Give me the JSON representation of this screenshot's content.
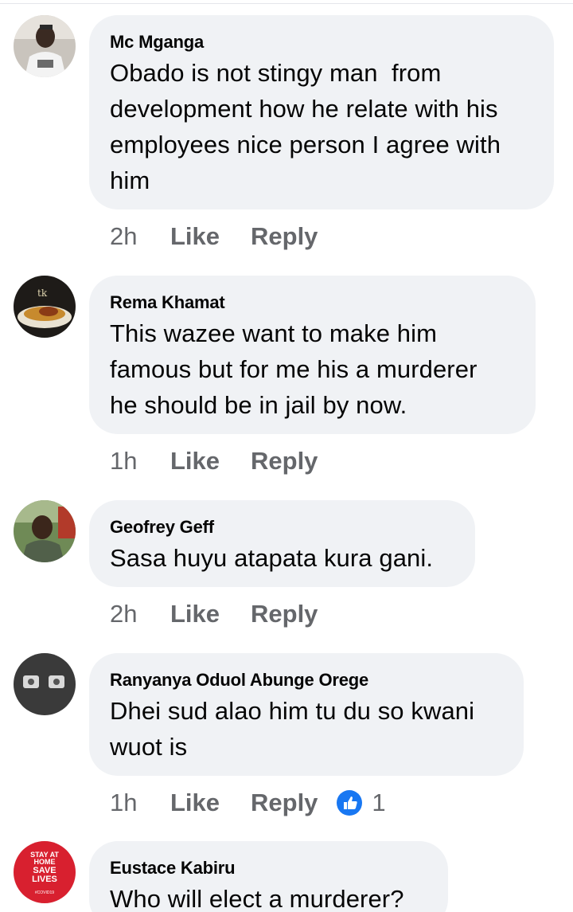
{
  "comments": [
    {
      "author": "Mc Mganga",
      "text_lines": [
        "Obado is not stingy man  from",
        "development how he relate with his",
        "employees nice person I agree with",
        "him"
      ],
      "time": "2h",
      "like_label": "Like",
      "reply_label": "Reply"
    },
    {
      "author": "Rema Khamat",
      "text_lines": [
        "This wazee want to make him",
        "famous but for me his a murderer",
        "he should be in jail by now."
      ],
      "time": "1h",
      "like_label": "Like",
      "reply_label": "Reply"
    },
    {
      "author": "Geofrey Geff",
      "text_lines": [
        "Sasa huyu atapata kura gani."
      ],
      "time": "2h",
      "like_label": "Like",
      "reply_label": "Reply"
    },
    {
      "author": "Ranyanya Oduol Abunge Orege",
      "text_lines": [
        "Dhei sud alao him tu du so kwani",
        "wuot is"
      ],
      "time": "1h",
      "like_label": "Like",
      "reply_label": "Reply",
      "reaction": {
        "icon": "thumbs-up-icon",
        "count": "1",
        "color": "#1877f2"
      }
    },
    {
      "author": "Eustace Kabiru",
      "text_lines": [
        "Who will elect a murderer?"
      ],
      "avatar_text": [
        "STAY AT",
        "HOME",
        "SAVE",
        "LIVES",
        "#COVID19"
      ]
    }
  ],
  "colors": {
    "bubble_bg": "#f0f2f5",
    "meta_text": "#65676b",
    "reaction_blue": "#1877f2"
  }
}
